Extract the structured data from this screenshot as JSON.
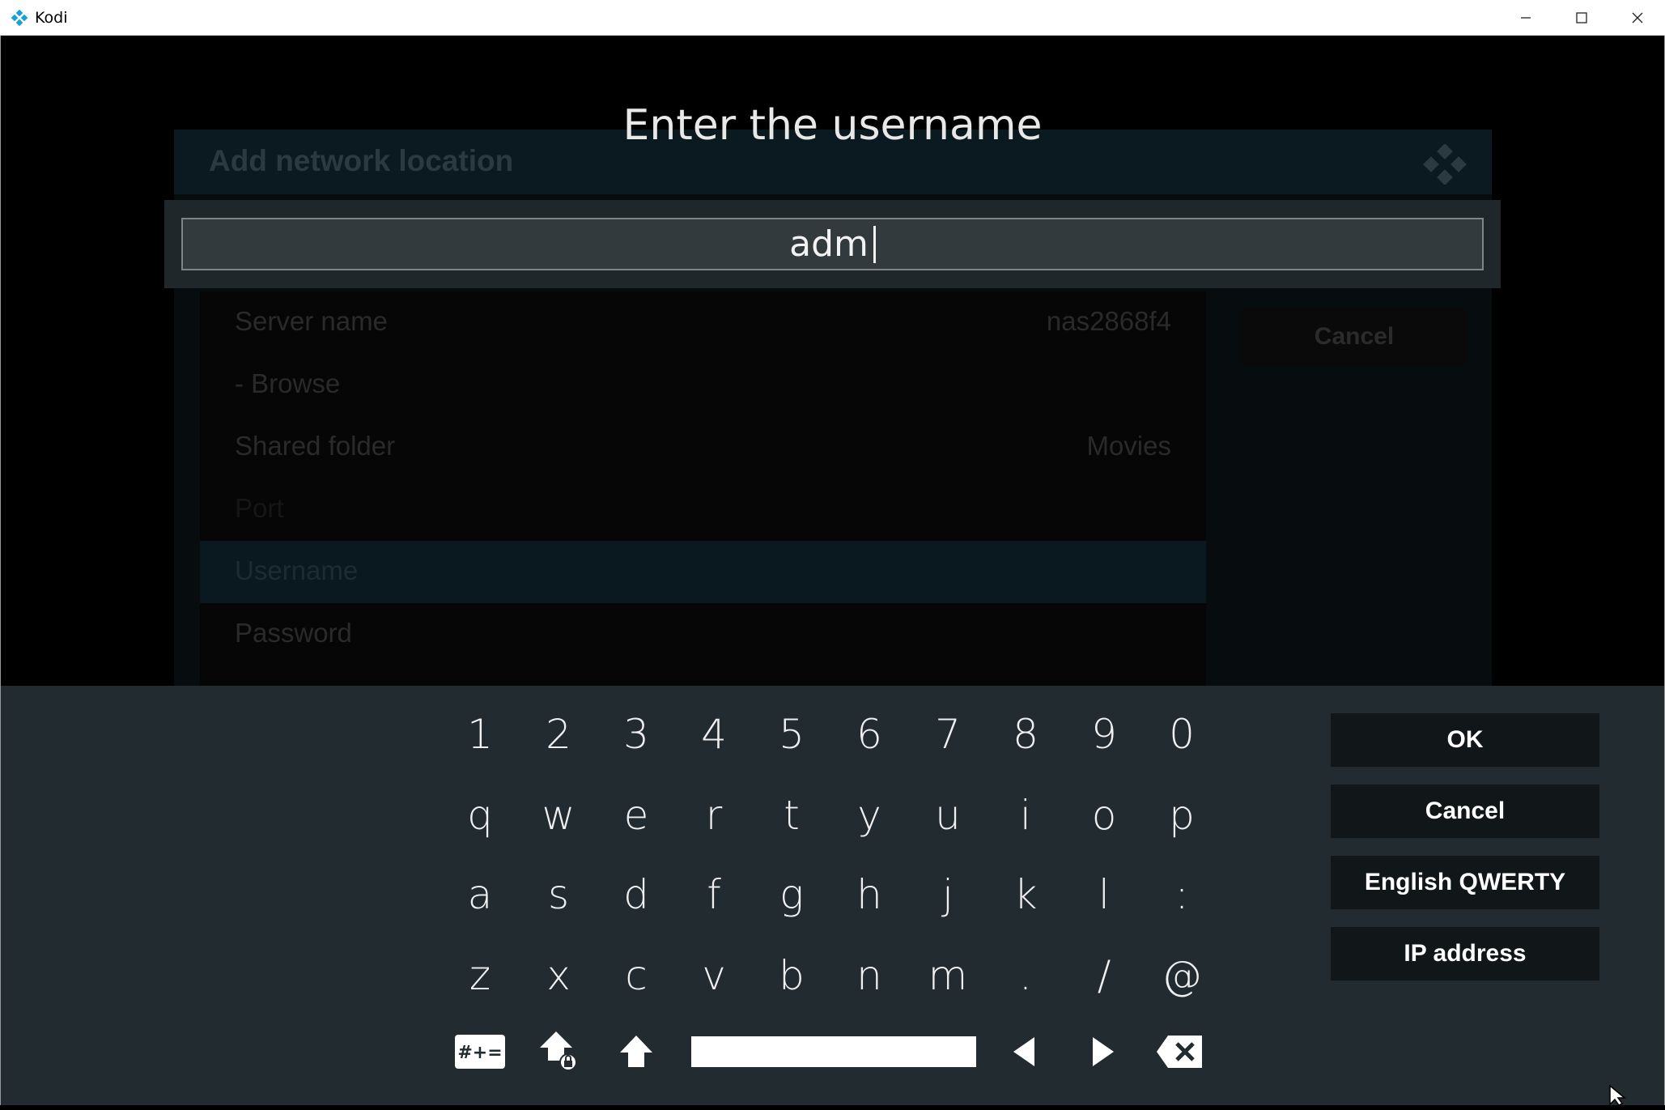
{
  "window": {
    "title": "Kodi",
    "controls": [
      "minimize-icon",
      "maximize-icon",
      "close-icon"
    ]
  },
  "background_dialog": {
    "title": "Add network location",
    "rows": [
      {
        "label": "Server name",
        "value": "nas2868f4"
      },
      {
        "label": "- Browse",
        "value": ""
      },
      {
        "label": "Shared folder",
        "value": "Movies"
      },
      {
        "label": "Port",
        "value": ""
      },
      {
        "label": "Username",
        "value": "",
        "selected": true
      },
      {
        "label": "Password",
        "value": ""
      }
    ],
    "cancel_label": "Cancel"
  },
  "keyboard_dialog": {
    "heading": "Enter the username",
    "input_value": "adm",
    "rows": [
      [
        "1",
        "2",
        "3",
        "4",
        "5",
        "6",
        "7",
        "8",
        "9",
        "0"
      ],
      [
        "q",
        "w",
        "e",
        "r",
        "t",
        "y",
        "u",
        "i",
        "o",
        "p"
      ],
      [
        "a",
        "s",
        "d",
        "f",
        "g",
        "h",
        "j",
        "k",
        "l",
        ":"
      ],
      [
        "z",
        "x",
        "c",
        "v",
        "b",
        "n",
        "m",
        ".",
        "/",
        "@"
      ]
    ],
    "special_keys": [
      "symbols-key",
      "caps-lock-key",
      "shift-key",
      "space-key",
      "left-arrow-key",
      "right-arrow-key",
      "backspace-key"
    ],
    "symbols_label": "#+=",
    "buttons": {
      "ok": "OK",
      "cancel": "Cancel",
      "layout": "English QWERTY",
      "ip": "IP address"
    }
  },
  "colors": {
    "accent": "#12a0d8",
    "keyboard_bg": "#212b30",
    "button_bg": "#111618"
  }
}
